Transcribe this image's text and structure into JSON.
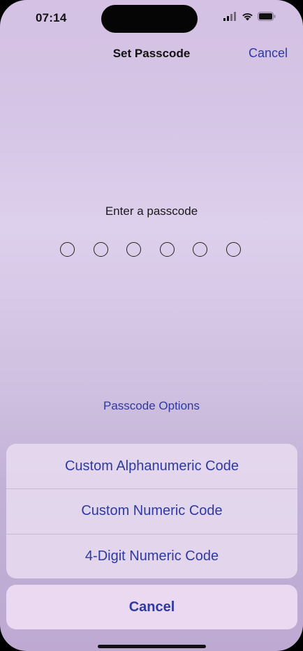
{
  "status_bar": {
    "time": "07:14",
    "icons": [
      "signal-icon",
      "wifi-icon",
      "battery-icon"
    ]
  },
  "nav": {
    "title": "Set Passcode",
    "cancel_label": "Cancel"
  },
  "passcode": {
    "prompt": "Enter a passcode",
    "digit_count": 6
  },
  "options_link": "Passcode Options",
  "action_sheet": {
    "items": [
      {
        "label": "Custom Alphanumeric Code"
      },
      {
        "label": "Custom Numeric Code"
      },
      {
        "label": "4-Digit Numeric Code"
      }
    ],
    "cancel_label": "Cancel"
  },
  "colors": {
    "accent": "#2f3aa0",
    "background_top": "#d4c1e3",
    "background_bottom": "#bda9d2"
  }
}
